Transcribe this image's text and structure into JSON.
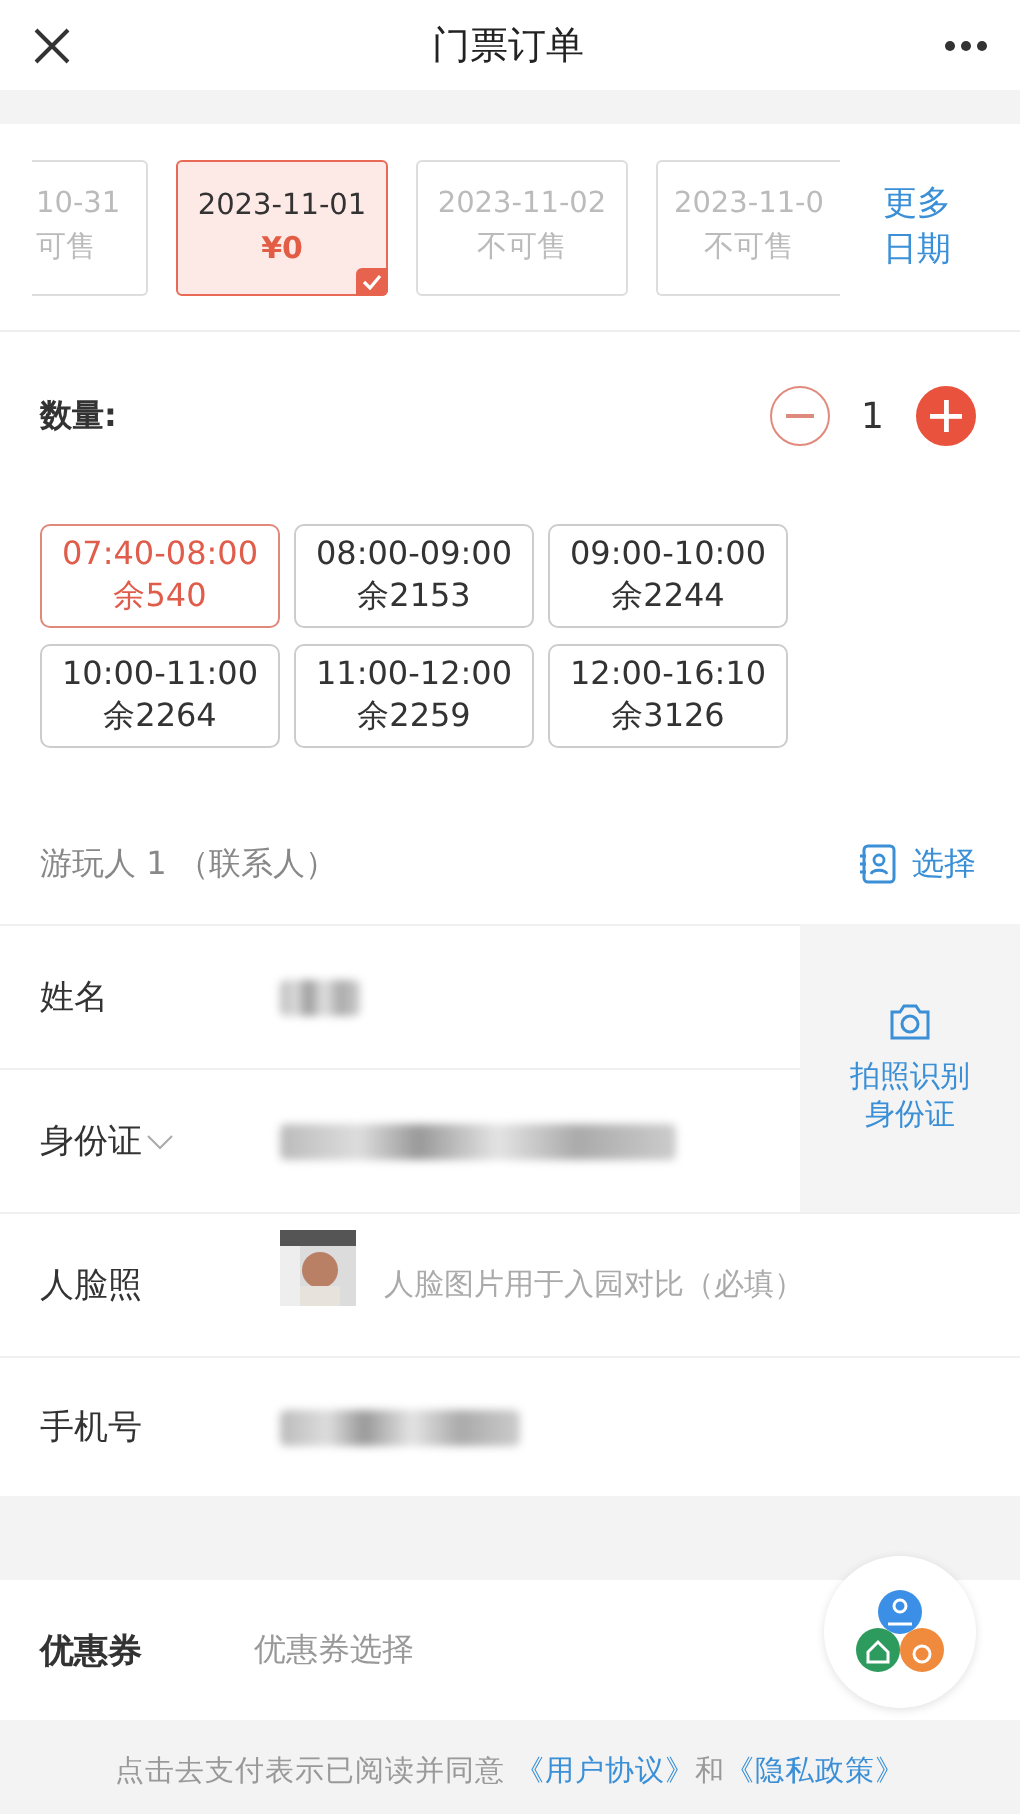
{
  "header": {
    "title": "门票订单"
  },
  "dates": [
    {
      "date": "10-31",
      "status": "可售",
      "selected": false,
      "kind": "cutleft"
    },
    {
      "date": "2023-11-01",
      "status": "¥0",
      "selected": true,
      "kind": "full"
    },
    {
      "date": "2023-11-02",
      "status": "不可售",
      "selected": false,
      "kind": "full"
    },
    {
      "date": "2023-11-0",
      "status": "不可售",
      "selected": false,
      "kind": "cutright"
    }
  ],
  "more_dates": "更多日期",
  "quantity": {
    "label": "数量:",
    "value": "1"
  },
  "slots": [
    {
      "time": "07:40-08:00",
      "remain": "余540",
      "selected": true
    },
    {
      "time": "08:00-09:00",
      "remain": "余2153",
      "selected": false
    },
    {
      "time": "09:00-10:00",
      "remain": "余2244",
      "selected": false
    },
    {
      "time": "10:00-11:00",
      "remain": "余2264",
      "selected": false
    },
    {
      "time": "11:00-12:00",
      "remain": "余2259",
      "selected": false
    },
    {
      "time": "12:00-16:10",
      "remain": "余3126",
      "selected": false
    }
  ],
  "visitor": {
    "title": "游玩人 1 （联系人）",
    "select": "选择"
  },
  "fields": [
    {
      "label": "姓名",
      "kind": "redacted-short"
    },
    {
      "label": "身份证",
      "kind": "redacted-id"
    },
    {
      "label": "人脸照",
      "hint": "人脸图片用于入园对比（必填）"
    },
    {
      "label": "手机号",
      "kind": "redacted-phone"
    }
  ],
  "ocr": {
    "label": "拍照识别身份证"
  },
  "coupon": {
    "label": "优惠券",
    "hint": "优惠券选择"
  },
  "agreement": {
    "text": "点击去支付表示已阅读并同意",
    "links": [
      "《用户协议》",
      "《隐私政策》"
    ],
    "joiner": "和"
  }
}
